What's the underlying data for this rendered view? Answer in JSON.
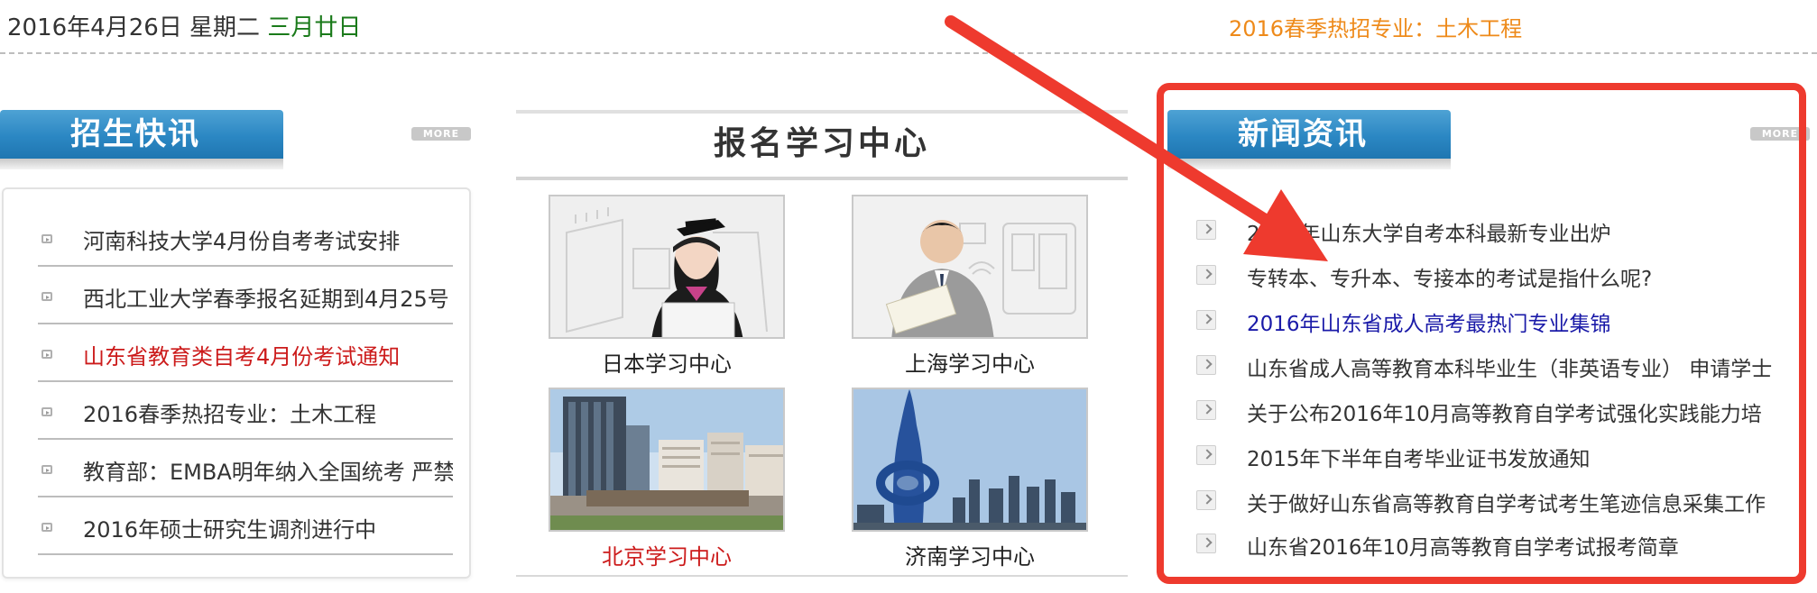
{
  "header": {
    "date": "2016年4月26日 星期二",
    "lunar_date": "三月廿日",
    "hot_major": "2016春季热招专业：土木工程"
  },
  "admissions_news": {
    "title": "招生快讯",
    "more_label": "MORE",
    "items": [
      {
        "text": "河南科技大学4月份自考考试安排"
      },
      {
        "text": "西北工业大学春季报名延期到4月25号！"
      },
      {
        "text": "山东省教育类自考4月份考试通知"
      },
      {
        "text": "2016春季热招专业：土木工程"
      },
      {
        "text": "教育部：EMBA明年纳入全国统考 严禁"
      },
      {
        "text": "2016年硕士研究生调剂进行中"
      }
    ]
  },
  "study_centers": {
    "title": "报名学习中心",
    "centers": [
      {
        "label": "日本学习中心"
      },
      {
        "label": "上海学习中心"
      },
      {
        "label": "北京学习中心"
      },
      {
        "label": "济南学习中心"
      }
    ]
  },
  "news": {
    "title": "新闻资讯",
    "more_label": "MORE",
    "items": [
      {
        "text": "2016年山东大学自考本科最新专业出炉"
      },
      {
        "text": "专转本、专升本、专接本的考试是指什么呢?"
      },
      {
        "text": "2016年山东省成人高考最热门专业集锦"
      },
      {
        "text": "山东省成人高等教育本科毕业生（非英语专业） 申请学士"
      },
      {
        "text": "关于公布2016年10月高等教育自学考试强化实践能力培"
      },
      {
        "text": "2015年下半年自考毕业证书发放通知"
      },
      {
        "text": "关于做好山东省高等教育自学考试考生笔迹信息采集工作"
      },
      {
        "text": "山东省2016年10月高等教育自学考试报考简章"
      }
    ]
  },
  "colors": {
    "tab_blue": "#2b87c3",
    "highlight_red": "#cc1b1b",
    "link_blue": "#1a1aa8",
    "annotation_red": "#ee3a2e",
    "hot_orange": "#ee8a1a",
    "lunar_green": "#1a7a1a"
  }
}
